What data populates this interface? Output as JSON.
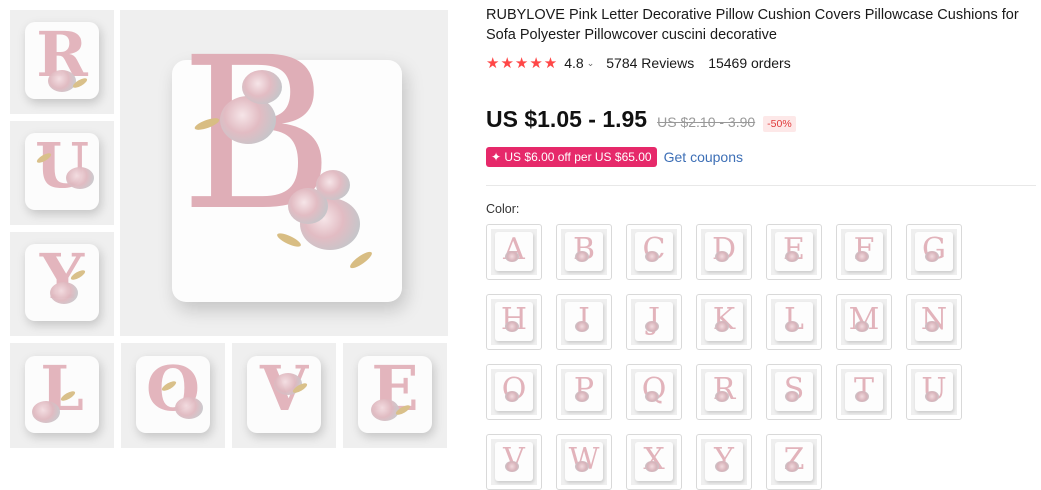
{
  "gallery": {
    "thumbnails": [
      {
        "letter": "R"
      },
      {
        "letter": "U"
      },
      {
        "letter": "Y"
      },
      {
        "letter": "L"
      },
      {
        "letter": "O"
      },
      {
        "letter": "V"
      },
      {
        "letter": "E"
      }
    ],
    "main_letter": "B"
  },
  "product": {
    "title": "RUBYLOVE Pink Letter Decorative Pillow Cushion Covers Pillowcase Cushions for Sofa Polyester Pillowcover cuscini decorative",
    "stars": "★★★★★",
    "rating": "4.8",
    "rating_caret": "⌄",
    "reviews": "5784 Reviews",
    "orders": "15469 orders",
    "price": "US $1.05 - 1.95",
    "old_price": "US $2.10 - 3.90",
    "discount": "-50%",
    "coupon": "✦ US $6.00 off per US $65.00",
    "get_coupons": "Get coupons",
    "color_label": "Color:"
  },
  "colors": {
    "swatch_letters": [
      "A",
      "B",
      "C",
      "D",
      "E",
      "F",
      "G",
      "H",
      "I",
      "J",
      "K",
      "L",
      "M",
      "N",
      "O",
      "P",
      "Q",
      "R",
      "S",
      "T",
      "U",
      "V",
      "W",
      "X",
      "Y",
      "Z"
    ],
    "accent_red": "#ff4747",
    "coupon_pink": "#e6296a",
    "link_blue": "#3d6fb6"
  }
}
